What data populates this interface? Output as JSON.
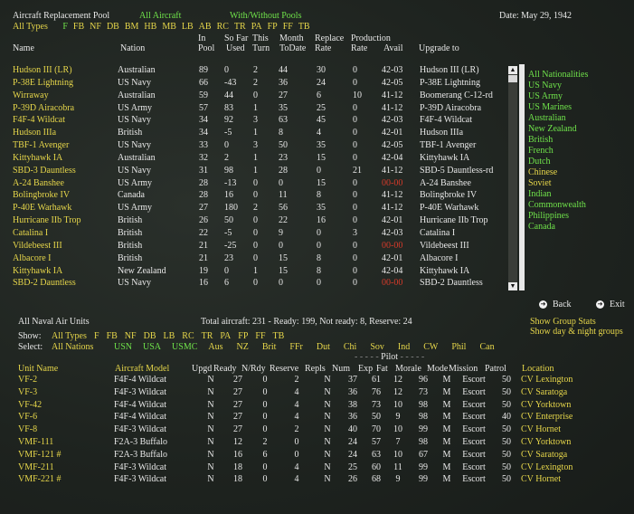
{
  "title": "Aircraft Replacement Pool",
  "filter_all_aircraft": "All Aircraft",
  "filter_pools": "With/Without Pools",
  "date": "Date: May 29, 1942",
  "types_label": "All Types",
  "types": [
    "F",
    "FB",
    "NF",
    "DB",
    "BM",
    "HB",
    "MB",
    "LB",
    "AB",
    "RC",
    "TR",
    "PA",
    "FP",
    "FF",
    "TB"
  ],
  "types_colors": [
    "#6fe24a",
    "#e6d64a",
    "#e6d64a",
    "#e6d64a",
    "#e6d64a",
    "#e6d64a",
    "#e6d64a",
    "#e6d64a",
    "#e6d64a",
    "#e6d64a",
    "#e6d64a",
    "#e6d64a",
    "#e6d64a",
    "#e6d64a",
    "#e6d64a"
  ],
  "pool_headers": {
    "name": "Name",
    "nation": "Nation",
    "in_pool_1": "In",
    "in_pool_2": "Pool",
    "sofar_1": "So Far",
    "sofar_2": "Used",
    "thisturn_1": "This",
    "thisturn_2": "Turn",
    "month_1": "Month",
    "month_2": "ToDate",
    "replace_1": "Replace",
    "replace_2": "Rate",
    "prod_1": "Production",
    "prod_2": "Rate",
    "avail": "Avail",
    "upgrade": "Upgrade to"
  },
  "pool_rows": [
    [
      "Hudson III (LR)",
      "Australian",
      "89",
      "0",
      "2",
      "44",
      "30",
      "0",
      "42-03",
      "Hudson III (LR)",
      false
    ],
    [
      "P-38E Lightning",
      "US Navy",
      "66",
      "-43",
      "2",
      "36",
      "24",
      "0",
      "42-05",
      "P-38E Lightning",
      false
    ],
    [
      "Wirraway",
      "Australian",
      "59",
      "44",
      "0",
      "27",
      "6",
      "10",
      "41-12",
      "Boomerang C-12-rd",
      false
    ],
    [
      "P-39D Airacobra",
      "US Army",
      "57",
      "83",
      "1",
      "35",
      "25",
      "0",
      "41-12",
      "P-39D Airacobra",
      false
    ],
    [
      "F4F-4 Wildcat",
      "US Navy",
      "34",
      "92",
      "3",
      "63",
      "45",
      "0",
      "42-03",
      "F4F-4 Wildcat",
      false
    ],
    [
      "Hudson IIIa",
      "British",
      "34",
      "-5",
      "1",
      "8",
      "4",
      "0",
      "42-01",
      "Hudson IIIa",
      false
    ],
    [
      "TBF-1 Avenger",
      "US Navy",
      "33",
      "0",
      "3",
      "50",
      "35",
      "0",
      "42-05",
      "TBF-1 Avenger",
      false
    ],
    [
      "Kittyhawk IA",
      "Australian",
      "32",
      "2",
      "1",
      "23",
      "15",
      "0",
      "42-04",
      "Kittyhawk IA",
      false
    ],
    [
      "SBD-3 Dauntless",
      "US Navy",
      "31",
      "98",
      "1",
      "28",
      "0",
      "21",
      "41-12",
      "SBD-5 Dauntless-rd",
      false
    ],
    [
      "A-24 Banshee",
      "US Army",
      "28",
      "-13",
      "0",
      "0",
      "15",
      "0",
      "00-00",
      "A-24 Banshee",
      true
    ],
    [
      "Bolingbroke IV",
      "Canada",
      "28",
      "16",
      "0",
      "11",
      "8",
      "0",
      "41-12",
      "Bolingbroke IV",
      false
    ],
    [
      "P-40E Warhawk",
      "US Army",
      "27",
      "180",
      "2",
      "56",
      "35",
      "0",
      "41-12",
      "P-40E Warhawk",
      false
    ],
    [
      "Hurricane IIb Trop",
      "British",
      "26",
      "50",
      "0",
      "22",
      "16",
      "0",
      "42-01",
      "Hurricane IIb Trop",
      false
    ],
    [
      "Catalina I",
      "British",
      "22",
      "-5",
      "0",
      "9",
      "0",
      "3",
      "42-03",
      "Catalina I",
      false
    ],
    [
      "Vildebeest III",
      "British",
      "21",
      "-25",
      "0",
      "0",
      "0",
      "0",
      "00-00",
      "Vildebeest III",
      true
    ],
    [
      "Albacore I",
      "British",
      "21",
      "23",
      "0",
      "15",
      "8",
      "0",
      "42-01",
      "Albacore I",
      false
    ],
    [
      "Kittyhawk IA",
      "New Zealand",
      "19",
      "0",
      "1",
      "15",
      "8",
      "0",
      "42-04",
      "Kittyhawk IA",
      false
    ],
    [
      "SBD-2 Dauntless",
      "US Navy",
      "16",
      "6",
      "0",
      "0",
      "0",
      "0",
      "00-00",
      "SBD-2 Dauntless",
      true
    ]
  ],
  "nationalities": [
    "All Nationalities",
    "US Navy",
    "US Army",
    "US Marines",
    "Australian",
    "New Zealand",
    "British",
    "French",
    "Dutch",
    "Chinese",
    "Soviet",
    "Indian",
    "Commonwealth",
    "Philippines",
    "Canada"
  ],
  "nationalities_colors": [
    "#6fe24a",
    "#6fe24a",
    "#6fe24a",
    "#6fe24a",
    "#6fe24a",
    "#6fe24a",
    "#6fe24a",
    "#6fe24a",
    "#6fe24a",
    "#e6d64a",
    "#e6d64a",
    "#6fe24a",
    "#6fe24a",
    "#6fe24a",
    "#6fe24a"
  ],
  "back_label": "Back",
  "exit_label": "Exit",
  "units_title": "All Naval Air Units",
  "totals": "Total aircraft: 231 - Ready: 199, Not ready: 8, Reserve: 24",
  "show_group_stats": "Show Group Stats",
  "show_day_night": "Show day & night groups",
  "show_label": "Show:",
  "show_all_types": "All Types",
  "show_types": [
    "F",
    "FB",
    "NF",
    "DB",
    "LB",
    "RC",
    "TR",
    "PA",
    "FP",
    "FF",
    "TB"
  ],
  "select_label": "Select:",
  "select_all_nations": "All Nations",
  "select_nations": [
    "USN",
    "USA",
    "USMC",
    "Aus",
    "NZ",
    "Brit",
    "FFr",
    "Dut",
    "Chi",
    "Sov",
    "Ind",
    "CW",
    "Phil",
    "Can"
  ],
  "select_nations_colors": [
    "#6fe24a",
    "#6fe24a",
    "#6fe24a",
    "#e6d64a",
    "#e6d64a",
    "#e6d64a",
    "#e6d64a",
    "#e6d64a",
    "#e6d64a",
    "#e6d64a",
    "#e6d64a",
    "#e6d64a",
    "#e6d64a",
    "#e6d64a"
  ],
  "pilot_label": "Pilot",
  "unit_headers": {
    "unit": "Unit Name",
    "model": "Aircraft Model",
    "upgd": "Upgd",
    "ready": "Ready",
    "nrdy": "N/Rdy",
    "reserve": "Reserve",
    "repls": "Repls",
    "num": "Num",
    "exp": "Exp",
    "fat": "Fat",
    "morale": "Morale",
    "mode": "Mode",
    "mission": "Mission",
    "patrol": "Patrol",
    "location": "Location"
  },
  "unit_rows": [
    [
      "VF-2",
      "F4F-4 Wildcat",
      "N",
      "27",
      "0",
      "2",
      "N",
      "37",
      "61",
      "12",
      "96",
      "M",
      "Escort",
      "50",
      "CV Lexington"
    ],
    [
      "VF-3",
      "F4F-3 Wildcat",
      "N",
      "27",
      "0",
      "4",
      "N",
      "36",
      "76",
      "12",
      "73",
      "M",
      "Escort",
      "50",
      "CV Saratoga"
    ],
    [
      "VF-42",
      "F4F-4 Wildcat",
      "N",
      "27",
      "0",
      "4",
      "N",
      "38",
      "73",
      "10",
      "98",
      "M",
      "Escort",
      "50",
      "CV Yorktown"
    ],
    [
      "VF-6",
      "F4F-4 Wildcat",
      "N",
      "27",
      "0",
      "4",
      "N",
      "36",
      "50",
      "9",
      "98",
      "M",
      "Escort",
      "40",
      "CV Enterprise"
    ],
    [
      "VF-8",
      "F4F-3 Wildcat",
      "N",
      "27",
      "0",
      "2",
      "N",
      "40",
      "70",
      "10",
      "99",
      "M",
      "Escort",
      "50",
      "CV Hornet"
    ],
    [
      "VMF-111",
      "F2A-3 Buffalo",
      "N",
      "12",
      "2",
      "0",
      "N",
      "24",
      "57",
      "7",
      "98",
      "M",
      "Escort",
      "50",
      "CV Yorktown"
    ],
    [
      "VMF-121 #",
      "F2A-3 Buffalo",
      "N",
      "16",
      "6",
      "0",
      "N",
      "24",
      "63",
      "10",
      "67",
      "M",
      "Escort",
      "50",
      "CV Saratoga"
    ],
    [
      "VMF-211",
      "F4F-3 Wildcat",
      "N",
      "18",
      "0",
      "4",
      "N",
      "25",
      "60",
      "11",
      "99",
      "M",
      "Escort",
      "50",
      "CV Lexington"
    ],
    [
      "VMF-221 #",
      "F4F-3 Wildcat",
      "N",
      "18",
      "0",
      "4",
      "N",
      "26",
      "68",
      "9",
      "99",
      "M",
      "Escort",
      "50",
      "CV Hornet"
    ]
  ]
}
